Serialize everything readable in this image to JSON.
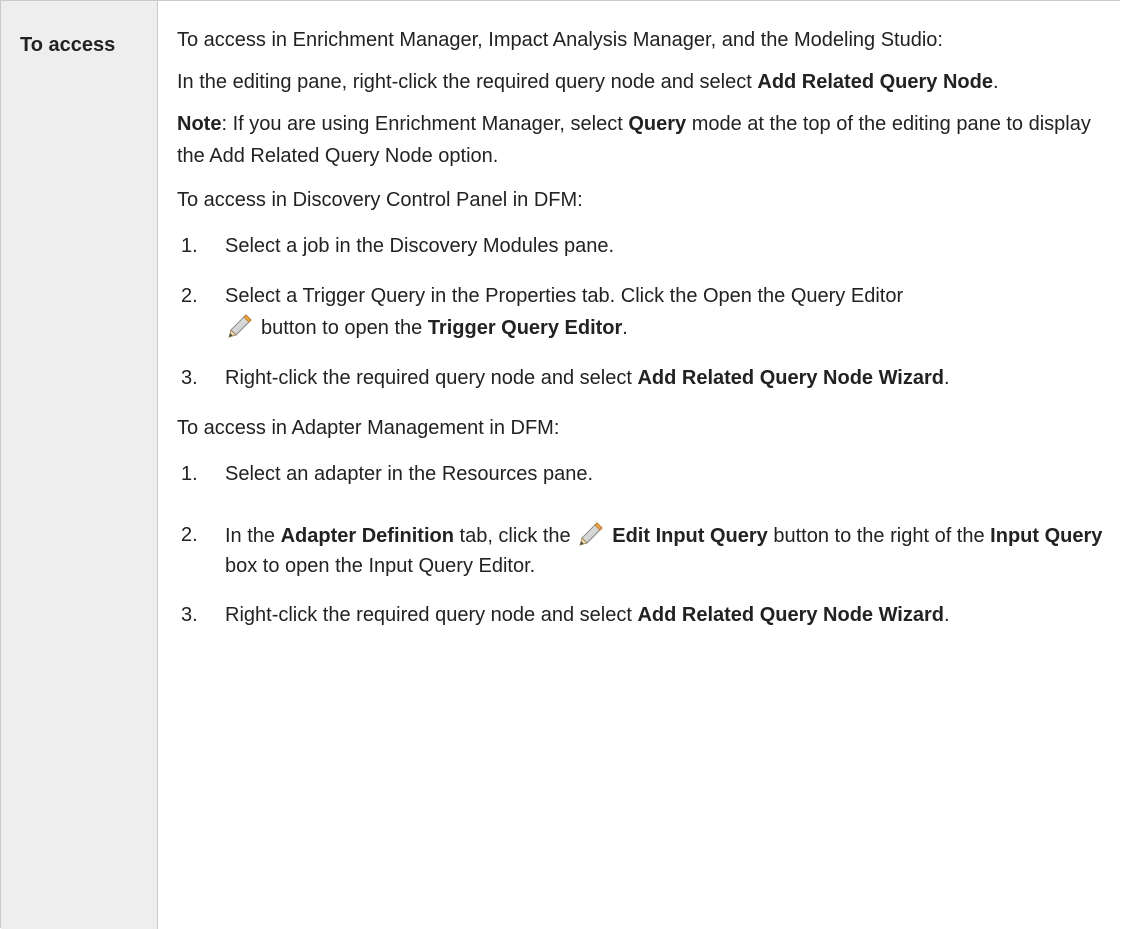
{
  "table": {
    "row_label": "To access"
  },
  "content": {
    "intro_1": "To access in Enrichment Manager, Impact Analysis Manager, and the Modeling Studio:",
    "intro_2": {
      "pre": "In the editing pane, right-click the required query node and select ",
      "bold": "Add Related Query Node",
      "post": "."
    },
    "note": {
      "label": "Note",
      "pre": ": If you are using Enrichment Manager, select ",
      "bold": "Query",
      "post": " mode at the top of the editing pane to display the Add Related Query Node option."
    },
    "dcp_heading": "To access in Discovery Control Panel in DFM:",
    "dcp_steps": [
      {
        "num": "1.",
        "text": "Select a job in the Discovery Modules pane."
      },
      {
        "num": "2.",
        "pre": "Select a Trigger Query in the Properties tab. Click the Open the Query Editor",
        "mid": "button to open the ",
        "bold": "Trigger Query Editor",
        "post": "."
      },
      {
        "num": "3.",
        "pre": "Right-click the required query node and select ",
        "bold": "Add Related Query Node Wizard",
        "post": "."
      }
    ],
    "am_heading": "To access in Adapter Management in DFM:",
    "am_steps": [
      {
        "num": "1.",
        "text": "Select an adapter in the Resources pane."
      },
      {
        "num": "2.",
        "pre": "In the ",
        "bold1": "Adapter Definition",
        "mid1": " tab, click the ",
        "bold2": "Edit Input Query",
        "mid2": " button to the right of the ",
        "bold3": "Input Query",
        "post": " box to open the Input Query Editor."
      },
      {
        "num": "3.",
        "pre": "Right-click the required query node and select ",
        "bold": "Add Related Query Node Wizard",
        "post": "."
      }
    ],
    "icons": {
      "edit": "pencil-icon"
    },
    "colors": {
      "label_bg": "#eeeeee",
      "border": "#c9c9c9",
      "text": "#222222"
    }
  }
}
